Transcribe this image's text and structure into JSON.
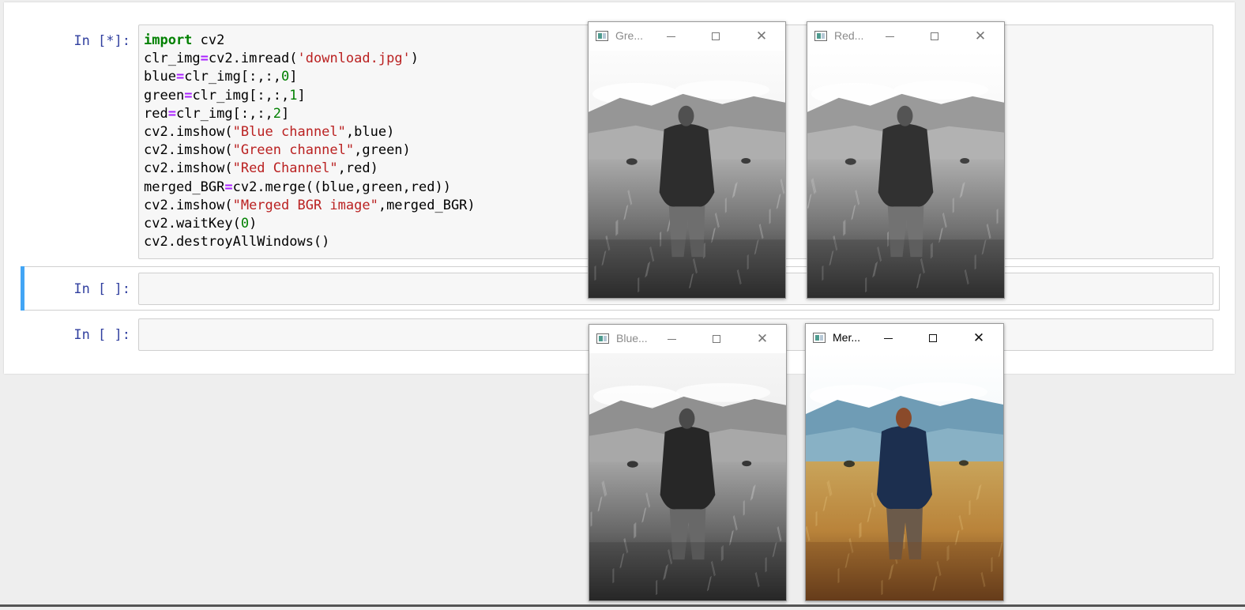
{
  "cells": [
    {
      "prompt": "In [*]:",
      "code_lines": [
        [
          [
            "kw",
            "import"
          ],
          [
            "t",
            " cv2"
          ]
        ],
        [
          [
            "t",
            "clr_img"
          ],
          [
            "op",
            "="
          ],
          [
            "t",
            "cv2.imread("
          ],
          [
            "str",
            "'download.jpg'"
          ],
          [
            "t",
            ")"
          ]
        ],
        [
          [
            "t",
            "blue"
          ],
          [
            "op",
            "="
          ],
          [
            "t",
            "clr_img[:,:,"
          ],
          [
            "num",
            "0"
          ],
          [
            "t",
            "]"
          ]
        ],
        [
          [
            "t",
            "green"
          ],
          [
            "op",
            "="
          ],
          [
            "t",
            "clr_img[:,:,"
          ],
          [
            "num",
            "1"
          ],
          [
            "t",
            "]"
          ]
        ],
        [
          [
            "t",
            "red"
          ],
          [
            "op",
            "="
          ],
          [
            "t",
            "clr_img[:,:,"
          ],
          [
            "num",
            "2"
          ],
          [
            "t",
            "]"
          ]
        ],
        [
          [
            "t",
            "cv2.imshow("
          ],
          [
            "str",
            "\"Blue channel\""
          ],
          [
            "t",
            ",blue)"
          ]
        ],
        [
          [
            "t",
            "cv2.imshow("
          ],
          [
            "str",
            "\"Green channel\""
          ],
          [
            "t",
            ",green)"
          ]
        ],
        [
          [
            "t",
            "cv2.imshow("
          ],
          [
            "str",
            "\"Red Channel\""
          ],
          [
            "t",
            ",red)"
          ]
        ],
        [
          [
            "t",
            "merged_BGR"
          ],
          [
            "op",
            "="
          ],
          [
            "t",
            "cv2.merge((blue,green,red))"
          ]
        ],
        [
          [
            "t",
            "cv2.imshow("
          ],
          [
            "str",
            "\"Merged BGR image\""
          ],
          [
            "t",
            ",merged_BGR)"
          ]
        ],
        [
          [
            "t",
            "cv2.waitKey("
          ],
          [
            "num",
            "0"
          ],
          [
            "t",
            ")"
          ]
        ],
        [
          [
            "t",
            "cv2.destroyAllWindows()"
          ]
        ]
      ]
    },
    {
      "prompt": "In [ ]:",
      "code_lines": []
    },
    {
      "prompt": "In [ ]:",
      "code_lines": []
    }
  ],
  "windows": [
    {
      "title": "Gre...",
      "active": false,
      "image": "grayscale"
    },
    {
      "title": "Red...",
      "active": false,
      "image": "grayscale"
    },
    {
      "title": "Blue...",
      "active": false,
      "image": "grayscale"
    },
    {
      "title": "Mer...",
      "active": true,
      "image": "color"
    }
  ],
  "colors": {
    "prompt": "#303f9f",
    "keyword": "#008000",
    "operator": "#aa22ff",
    "string": "#ba2121",
    "number": "#008000",
    "selected_cell_bar": "#42a5f5"
  }
}
